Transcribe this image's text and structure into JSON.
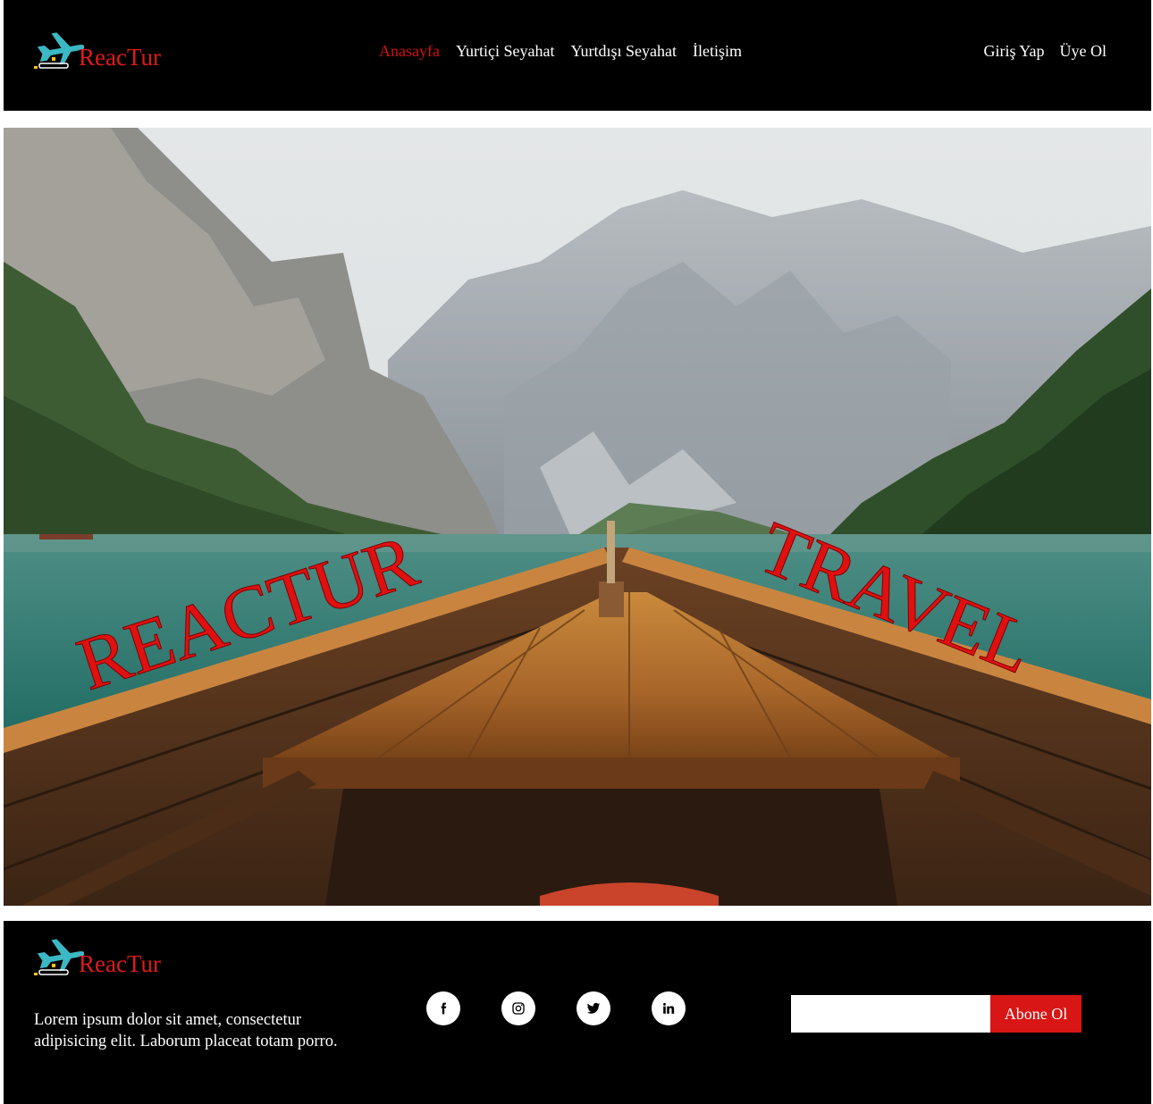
{
  "header": {
    "logo_text": "ReacTur",
    "nav": [
      {
        "label": "Anasayfa",
        "active": true
      },
      {
        "label": "Yurtiçi Seyahat",
        "active": false
      },
      {
        "label": "Yurtdışı Seyahat",
        "active": false
      },
      {
        "label": "İletişim",
        "active": false
      }
    ],
    "auth": {
      "login": "Giriş Yap",
      "register": "Üye Ol"
    }
  },
  "hero": {
    "word_left": "REACTUR",
    "word_right": "TRAVEL",
    "text_color": "#e01010"
  },
  "footer": {
    "logo_text": "ReacTur",
    "description": "Lorem ipsum dolor sit amet, consectetur adipisicing elit. Laborum placeat totam porro.",
    "social": [
      "facebook-icon",
      "instagram-icon",
      "twitter-icon",
      "linkedin-icon"
    ],
    "subscribe": {
      "placeholder": "",
      "button_label": "Abone Ol"
    }
  },
  "colors": {
    "accent": "#e01a1a",
    "background": "#000000"
  }
}
